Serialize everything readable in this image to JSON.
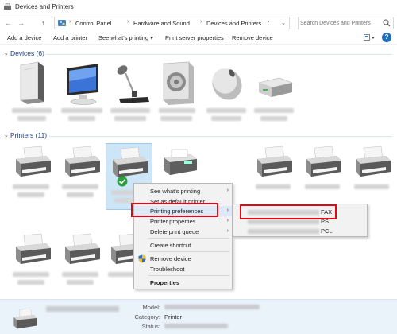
{
  "window": {
    "title": "Devices and Printers"
  },
  "nav": {
    "back": "←",
    "forward": "→",
    "up": "↑",
    "refresh": "⟳"
  },
  "address": {
    "root_chevron": "›",
    "crumbs": [
      "Control Panel",
      "Hardware and Sound",
      "Devices and Printers"
    ],
    "separators": [
      "›",
      "›",
      "›"
    ],
    "dropdown": "⌄"
  },
  "search": {
    "placeholder": "Search Devices and Printers"
  },
  "toolbar": {
    "add_device": "Add a device",
    "add_printer": "Add a printer",
    "see_printing": "See what's printing ▾",
    "server_properties": "Print server properties",
    "remove_device": "Remove device",
    "help": "?"
  },
  "groups": {
    "devices": {
      "chevron": "⌄",
      "label": "Devices (6)"
    },
    "printers": {
      "chevron": "⌄",
      "label": "Printers (11)"
    }
  },
  "devices": [
    {
      "icon": "computer-tower-icon"
    },
    {
      "icon": "monitor-icon"
    },
    {
      "icon": "microphone-icon"
    },
    {
      "icon": "speaker-icon"
    },
    {
      "icon": "mouse-icon"
    },
    {
      "icon": "external-drive-icon"
    }
  ],
  "context_menu": {
    "items": [
      {
        "label": "See what's printing",
        "arrow": "›"
      },
      {
        "label": "Set as default printer",
        "arrow": ""
      },
      {
        "label": "Printing preferences",
        "arrow": "›"
      },
      {
        "label": "Printer properties",
        "arrow": "›"
      },
      {
        "label": "Delete print queue",
        "arrow": "›"
      },
      {
        "label": "Create shortcut",
        "arrow": ""
      },
      {
        "label": "Remove device",
        "arrow": ""
      },
      {
        "label": "Troubleshoot",
        "arrow": ""
      },
      {
        "label": "Properties",
        "arrow": ""
      }
    ]
  },
  "submenu": {
    "items": [
      {
        "label": "FAX"
      },
      {
        "label": "PS"
      },
      {
        "label": "PCL"
      }
    ]
  },
  "details": {
    "model_label": "Model:",
    "category_label": "Category:",
    "category_value": "Printer",
    "status_label": "Status:"
  },
  "colors": {
    "highlight": "#e30613",
    "group_label": "#1e3f7a",
    "selection": "#cde6f7",
    "details_bg": "#eaf2fa"
  }
}
